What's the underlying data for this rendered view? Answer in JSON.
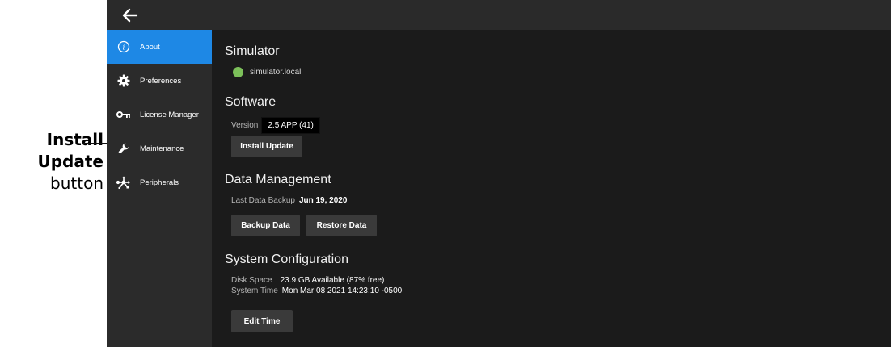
{
  "callout": {
    "line1": "Install",
    "line2": "Update",
    "line3": "button"
  },
  "nav": {
    "items": [
      {
        "label": "About",
        "icon": "info-icon",
        "active": true
      },
      {
        "label": "Preferences",
        "icon": "gear-icon",
        "active": false
      },
      {
        "label": "License Manager",
        "icon": "key-icon",
        "active": false
      },
      {
        "label": "Maintenance",
        "icon": "wrench-icon",
        "active": false
      },
      {
        "label": "Peripherals",
        "icon": "peripherals-icon",
        "active": false
      }
    ]
  },
  "main": {
    "device_title": "Simulator",
    "host": "simulator.local",
    "software_title": "Software",
    "version_label": "Version",
    "version_value": "2.5 APP (41)",
    "install_update_label": "Install Update",
    "data_mgmt_title": "Data Management",
    "last_backup_label": "Last Data Backup",
    "last_backup_value": "Jun 19, 2020",
    "backup_label": "Backup Data",
    "restore_label": "Restore Data",
    "sys_config_title": "System Configuration",
    "disk_label": "Disk Space",
    "disk_value": "23.9 GB Available (87% free)",
    "time_label": "System Time",
    "time_value": "Mon Mar 08 2021 14:23:10 -0500",
    "edit_time_label": "Edit Time"
  },
  "colors": {
    "accent": "#1e88e5",
    "status_online": "#7cc05a",
    "sidebar_bg": "#2b2b2b",
    "main_bg": "#1b1b1b"
  }
}
